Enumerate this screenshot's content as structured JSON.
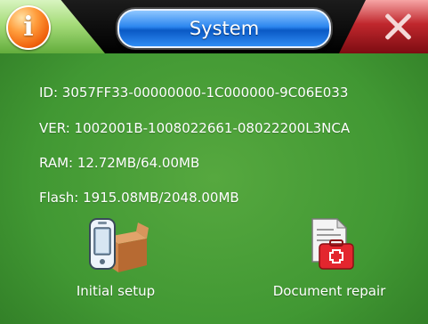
{
  "window": {
    "title": "System",
    "info_icon": "info-icon",
    "close_icon": "close-icon",
    "info_glyph": "i"
  },
  "info": {
    "id": "ID:  3057FF33-00000000-1C000000-9C06E033",
    "ver": "VER:  1002001B-1008022661-08022200L3NCA",
    "ram": "RAM:  12.72MB/64.00MB",
    "flash": "Flash:  1915.08MB/2048.00MB"
  },
  "actions": {
    "initial_setup": {
      "label": "Initial setup",
      "icon": "device-box-icon"
    },
    "document_repair": {
      "label": "Document repair",
      "icon": "first-aid-document-icon"
    }
  },
  "colors": {
    "background": "#419833",
    "title_pill": "#2c86ef",
    "info_button": "#ef5f0b",
    "close_button": "#c0272d"
  }
}
